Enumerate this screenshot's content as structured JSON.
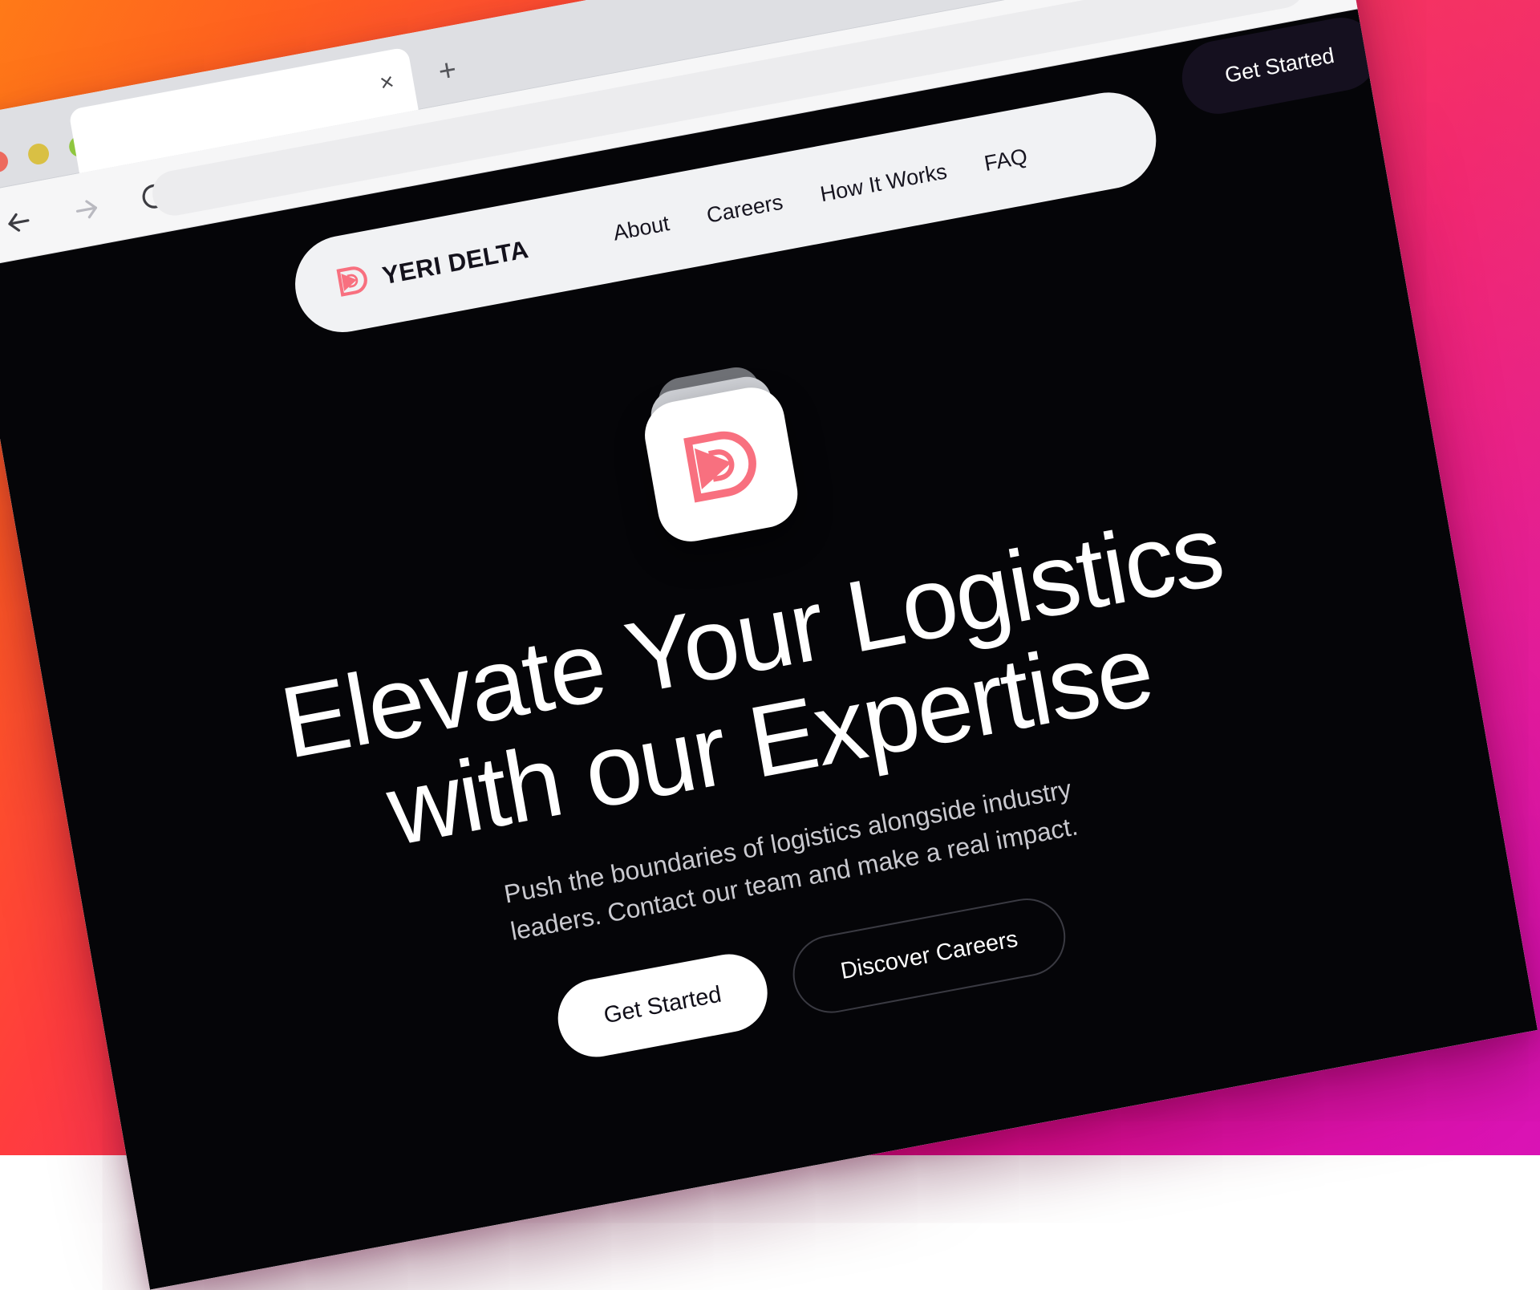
{
  "browser": {
    "traffic_lights": [
      "close-red",
      "minimize-yellow",
      "maximize-green"
    ],
    "tab": {
      "title": "",
      "close_label": "×"
    },
    "new_tab_label": "+",
    "toolbar": {
      "back_icon": "arrow-left-icon",
      "forward_icon": "arrow-right-icon",
      "reload_icon": "reload-icon",
      "address_value": "",
      "address_placeholder": ""
    }
  },
  "site": {
    "brand": {
      "name": "YERI DELTA",
      "mark": "delta-logo-icon",
      "accent": "#f8707f"
    },
    "nav_links": [
      {
        "label": "About"
      },
      {
        "label": "Careers"
      },
      {
        "label": "How It Works"
      },
      {
        "label": "FAQ"
      }
    ],
    "header_cta": {
      "label": "Get Started"
    },
    "hero": {
      "app_icon": "delta-app-icon",
      "headline_line1": "Elevate Your Logistics",
      "headline_line2": "with our Expertise",
      "subtitle_line1": "Push the boundaries of logistics alongside industry",
      "subtitle_line2": "leaders. Contact our team and make a real impact.",
      "primary_cta": {
        "label": "Get Started"
      },
      "secondary_cta": {
        "label": "Discover Careers"
      }
    }
  },
  "theme": {
    "page_bg": "#050508",
    "nav_pill_bg": "#f1f2f4",
    "dark_button": "#15101f",
    "text_light": "#ffffff",
    "muted_text": "#c9c9cf",
    "gradient_from": "#ff7a18",
    "gradient_mid": "#ff2e6a",
    "gradient_to": "#d913b5"
  }
}
